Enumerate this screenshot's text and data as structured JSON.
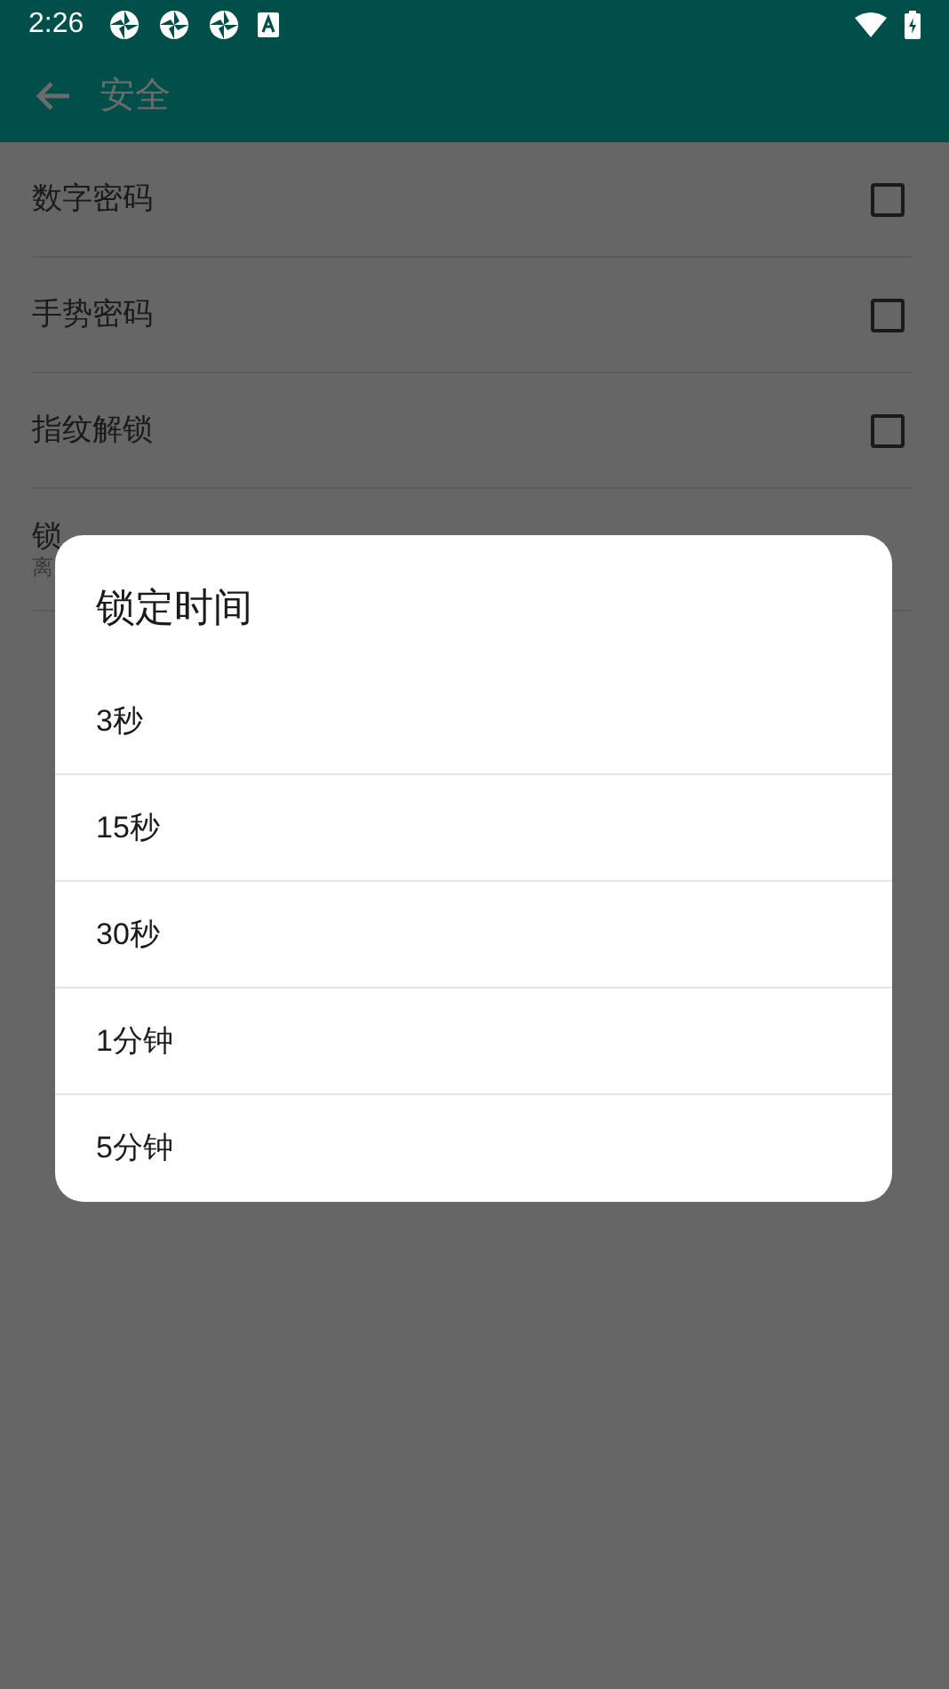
{
  "status_bar": {
    "time": "2:26"
  },
  "app_bar": {
    "title": "安全"
  },
  "settings": [
    {
      "kind": "checkbox",
      "label": "数字密码",
      "checked": false
    },
    {
      "kind": "checkbox",
      "label": "手势密码",
      "checked": false
    },
    {
      "kind": "checkbox",
      "label": "指纹解锁",
      "checked": false
    },
    {
      "kind": "detail",
      "label": "锁",
      "subtitle": "离"
    }
  ],
  "dialog": {
    "title": "锁定时间",
    "options": [
      "3秒",
      "15秒",
      "30秒",
      "1分钟",
      "5分钟"
    ]
  }
}
